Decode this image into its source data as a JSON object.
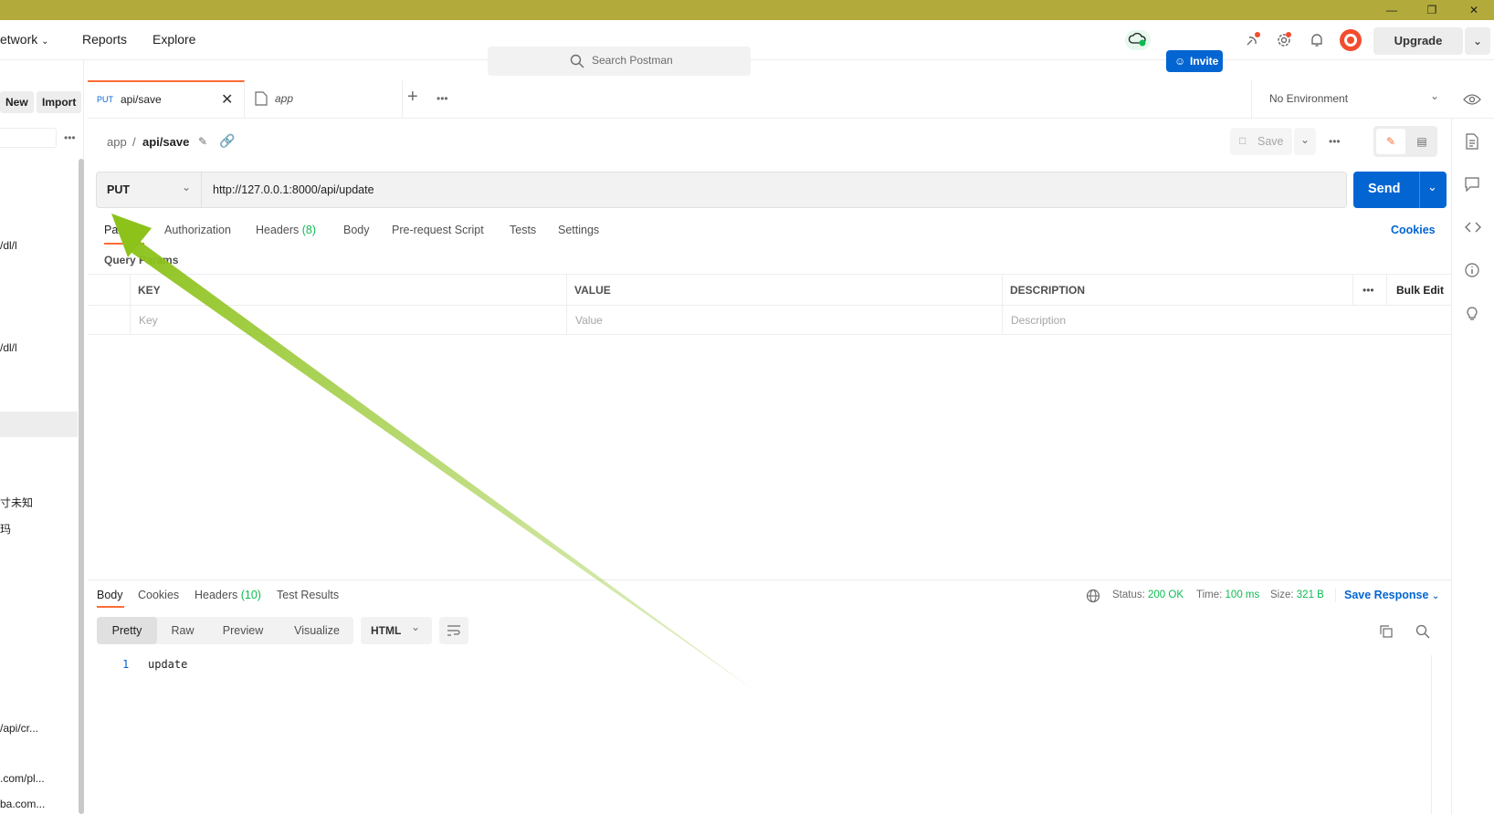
{
  "header": {
    "nav": [
      "etwork",
      "Reports",
      "Explore"
    ],
    "search_placeholder": "Search Postman",
    "invite_label": "Invite",
    "upgrade_label": "Upgrade"
  },
  "sidebar": {
    "new_label": "New",
    "import_label": "Import",
    "fragments": [
      "/dl/l",
      "/dl/l",
      "寸未知",
      "玛",
      "/api/cr...",
      ".com/pl...",
      "ba.com..."
    ]
  },
  "tabs": [
    {
      "method": "PUT",
      "name": "api/save"
    },
    {
      "name": "app"
    }
  ],
  "environment": "No Environment",
  "breadcrumb": {
    "parent": "app",
    "separator": "/",
    "current": "api/save"
  },
  "save_label": "Save",
  "request": {
    "method": "PUT",
    "url": "http://127.0.0.1:8000/api/update",
    "send_label": "Send"
  },
  "request_tabs": {
    "params": "Params",
    "authorization": "Authorization",
    "headers": "Headers",
    "headers_count": "(8)",
    "body": "Body",
    "prerequest": "Pre-request Script",
    "tests": "Tests",
    "settings": "Settings",
    "cookies": "Cookies"
  },
  "query_params": {
    "title": "Query Params",
    "columns": [
      "KEY",
      "VALUE",
      "DESCRIPTION"
    ],
    "bulk_edit": "Bulk Edit",
    "placeholders": [
      "Key",
      "Value",
      "Description"
    ]
  },
  "response": {
    "tabs": {
      "body": "Body",
      "cookies": "Cookies",
      "headers": "Headers",
      "headers_count": "(10)",
      "test_results": "Test Results"
    },
    "status_label": "Status:",
    "status_value": "200 OK",
    "time_label": "Time:",
    "time_value": "100 ms",
    "size_label": "Size:",
    "size_value": "321 B",
    "save_response": "Save Response",
    "views": [
      "Pretty",
      "Raw",
      "Preview",
      "Visualize"
    ],
    "format": "HTML",
    "lines": [
      {
        "num": "1",
        "text": "update"
      }
    ]
  },
  "colors": {
    "accent": "#0265d2",
    "success": "#0cbb52",
    "titlebar": "#b2ab3c",
    "arrow": "#8cc21a",
    "active_tab": "#ff6c37"
  }
}
